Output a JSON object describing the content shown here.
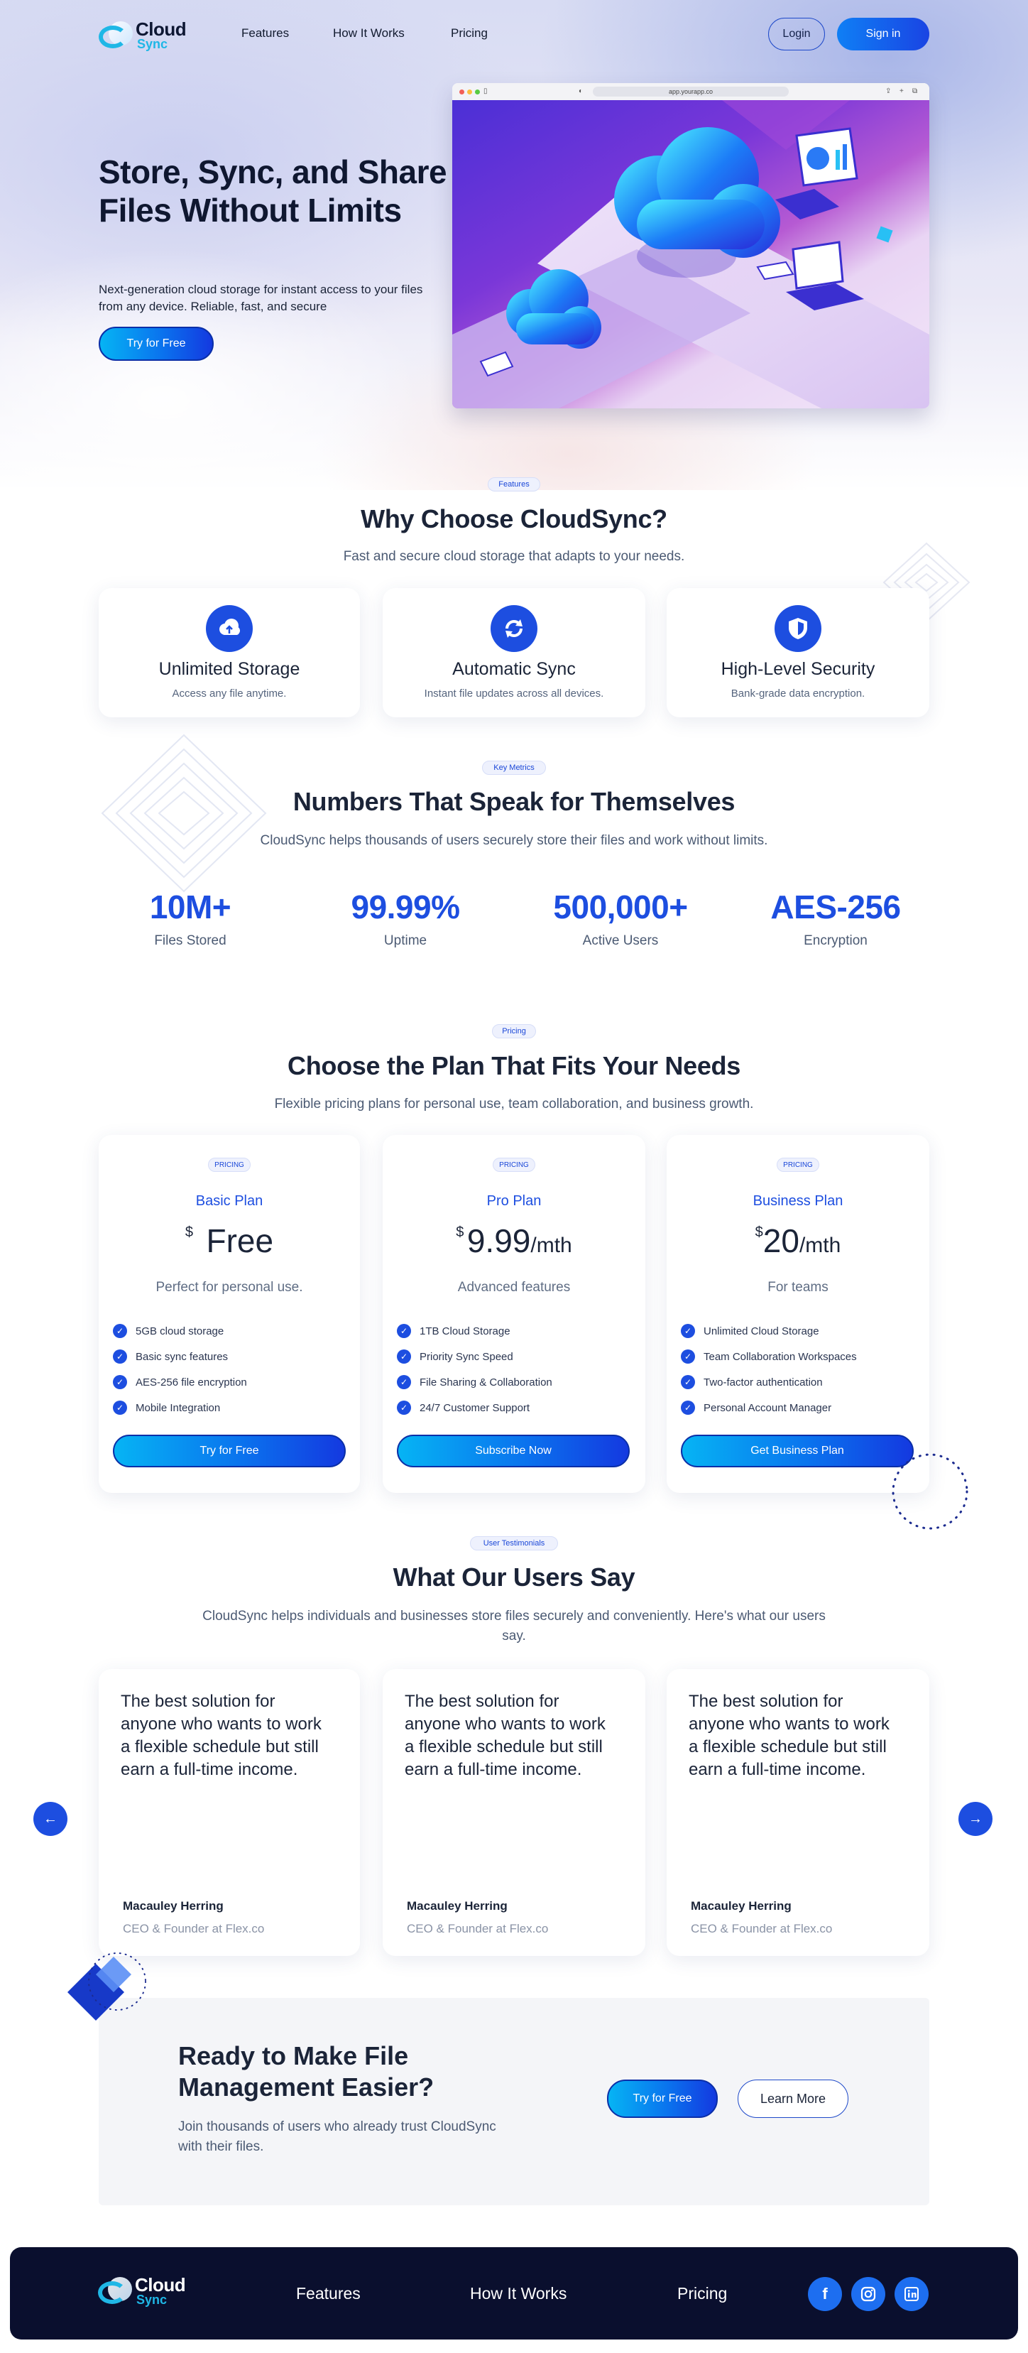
{
  "header": {
    "logo_top": "Cloud",
    "logo_bottom": "Sync",
    "nav": [
      "Features",
      "How It Works",
      "Pricing"
    ],
    "login_label": "Login",
    "signin_label": "Sign in"
  },
  "hero": {
    "title": "Store, Sync, and Share Files Without Limits",
    "subtitle": "Next-generation cloud storage for instant access to your files from any device. Reliable, fast, and secure",
    "cta_label": "Try for Free",
    "browser_url": "app.yourapp.co"
  },
  "features": {
    "pill": "Features",
    "title": "Why Choose CloudSync?",
    "subtitle": "Fast and secure cloud storage that adapts to your needs.",
    "items": [
      {
        "title": "Unlimited Storage",
        "desc": "Access any file anytime.",
        "icon": "cloud-upload-icon"
      },
      {
        "title": "Automatic Sync",
        "desc": "Instant file updates across all devices.",
        "icon": "sync-icon"
      },
      {
        "title": "High-Level Security",
        "desc": "Bank-grade data encryption.",
        "icon": "shield-icon"
      }
    ]
  },
  "metrics": {
    "pill": "Key Metrics",
    "title": "Numbers That Speak for Themselves",
    "subtitle": "CloudSync helps thousands of users securely store their files and work without limits.",
    "items": [
      {
        "value": "10M+",
        "label": "Files Stored"
      },
      {
        "value": "99.99%",
        "label": "Uptime"
      },
      {
        "value": "500,000+",
        "label": "Active Users"
      },
      {
        "value": "AES-256",
        "label": "Encryption"
      }
    ]
  },
  "pricing": {
    "pill": "Pricing",
    "title": "Choose the Plan That Fits Your Needs",
    "subtitle": "Flexible pricing plans for personal use, team collaboration, and business growth.",
    "plans": [
      {
        "pill": "PRICING",
        "name": "Basic Plan",
        "currency": "$",
        "amount": "Free",
        "period": "",
        "tagline": "Perfect for personal use.",
        "features": [
          "5GB cloud storage",
          "Basic sync features",
          "AES-256 file encryption",
          "Mobile Integration"
        ],
        "button": "Try for Free"
      },
      {
        "pill": "PRICING",
        "name": "Pro Plan",
        "currency": "$",
        "amount": "9.99",
        "period": "/mth",
        "tagline": "Advanced features",
        "features": [
          "1TB Cloud Storage",
          "Priority Sync Speed",
          "File Sharing & Collaboration",
          "24/7 Customer Support"
        ],
        "button": "Subscribe Now"
      },
      {
        "pill": "PRICING",
        "name": "Business Plan",
        "currency": "$",
        "amount": "20",
        "period": "/mth",
        "tagline": "For teams",
        "features": [
          "Unlimited Cloud Storage",
          "Team Collaboration Workspaces",
          "Two-factor authentication",
          "Personal Account Manager"
        ],
        "button": "Get Business Plan"
      }
    ]
  },
  "testimonials": {
    "pill": "User Testimonials",
    "title": "What Our Users Say",
    "subtitle": "CloudSync helps individuals and businesses store files securely and conveniently. Here's what our users say.",
    "items": [
      {
        "quote": "The best solution for anyone who wants to work a flexible schedule but still earn a full-time income.",
        "name": "Macauley Herring",
        "role": "CEO & Founder at Flex.co"
      },
      {
        "quote": "The best solution for anyone who wants to work a flexible schedule but still earn a full-time income.",
        "name": "Macauley Herring",
        "role": "CEO & Founder at Flex.co"
      },
      {
        "quote": "The best solution for anyone who wants to work a flexible schedule but still earn a full-time income.",
        "name": "Macauley Herring",
        "role": "CEO & Founder at Flex.co"
      }
    ]
  },
  "cta": {
    "title": "Ready to Make File Management Easier?",
    "subtitle": "Join thousands of users who already trust CloudSync with their files.",
    "primary": "Try for Free",
    "secondary": "Learn More"
  },
  "footer": {
    "logo_top": "Cloud",
    "logo_bottom": "Sync",
    "nav": [
      "Features",
      "How It Works",
      "Pricing"
    ],
    "social": [
      "facebook-icon",
      "instagram-icon",
      "linkedin-icon"
    ]
  },
  "colors": {
    "accent": "#1d4ee0",
    "accent_light": "#06b4f4",
    "text_dark": "#1b2438",
    "footer_bg": "#0a0f2e"
  }
}
